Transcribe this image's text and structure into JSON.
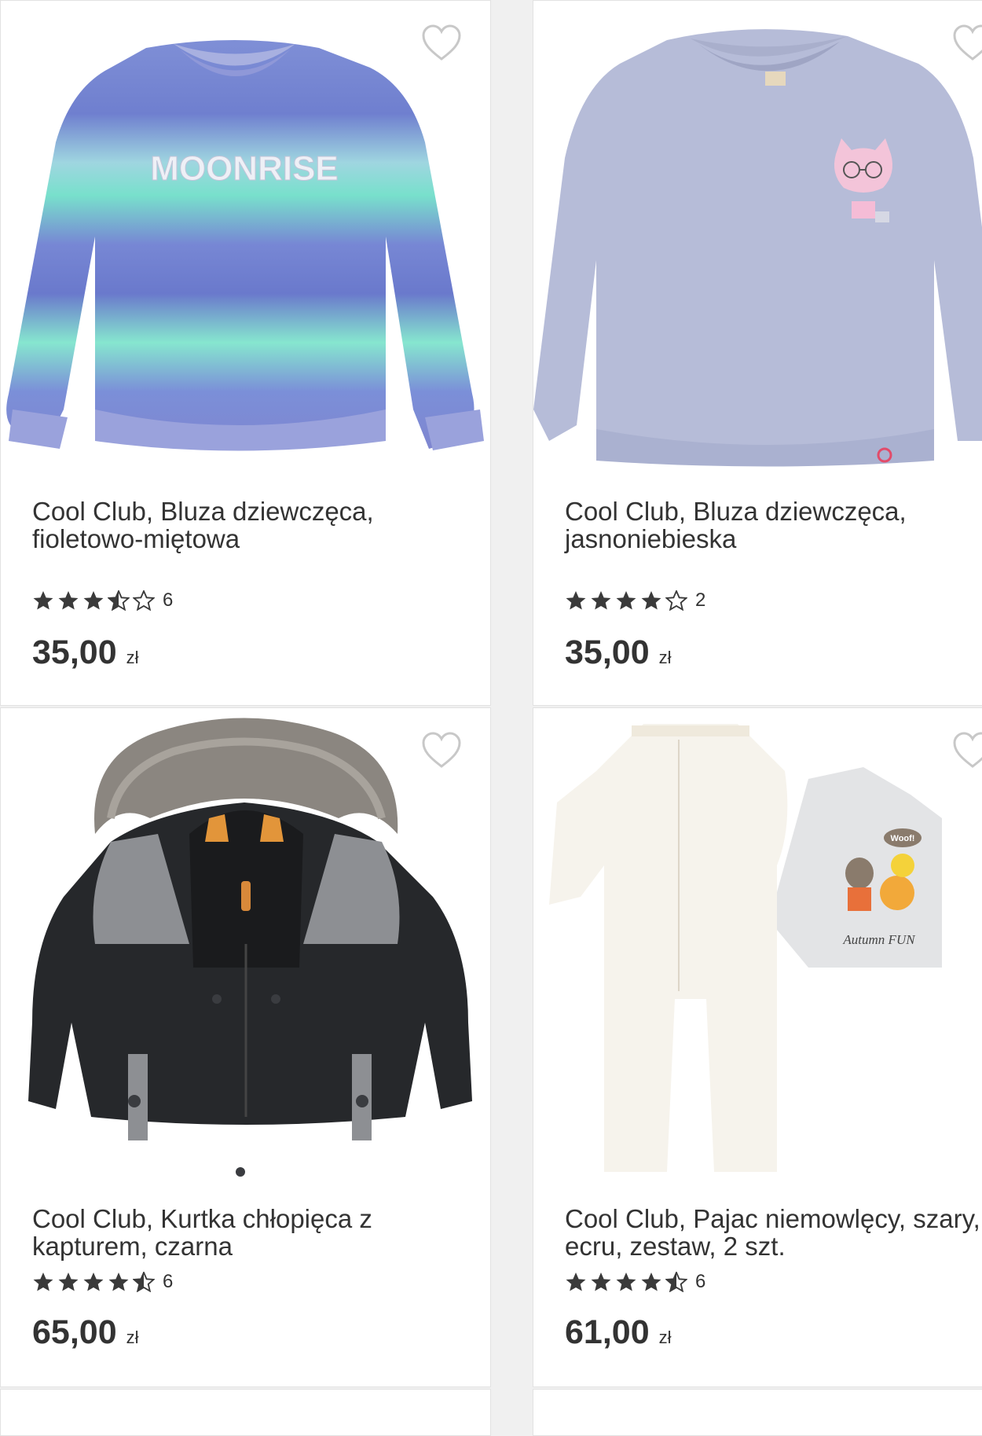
{
  "products": [
    {
      "title_line1": "Cool Club, Bluza dziewczęca,",
      "title_line2": "fioletowo-miętowa",
      "stars": [
        1,
        1,
        1,
        0.5,
        0
      ],
      "reviews": "6",
      "price": "35,00",
      "currency": "zł",
      "print_text": "MOONRISE",
      "image": "sweatshirt-ombre-icon"
    },
    {
      "title_line1": "Cool Club, Bluza dziewczęca,",
      "title_line2": "jasnoniebieska",
      "stars": [
        1,
        1,
        1,
        1,
        0
      ],
      "reviews": "2",
      "price": "35,00",
      "currency": "zł",
      "image": "sweatshirt-blue-icon"
    },
    {
      "title_line1": "Cool Club, Kurtka chłopięca z",
      "title_line2": "kapturem, czarna",
      "stars": [
        1,
        1,
        1,
        1,
        0.5
      ],
      "reviews": "6",
      "price": "65,00",
      "currency": "zł",
      "image": "winter-jacket-icon"
    },
    {
      "title_line1": "Cool Club, Pajac niemowlęcy, szary,",
      "title_line2": "ecru, zestaw, 2 szt.",
      "stars": [
        1,
        1,
        1,
        1,
        0.5
      ],
      "reviews": "6",
      "price": "61,00",
      "currency": "zł",
      "print_text": "Autumn FUN",
      "bubble_text": "Woof!",
      "image": "baby-romper-set-icon"
    }
  ],
  "colors": {
    "star": "#3a3a3a",
    "heart_outline": "#c8c8c8",
    "card_border": "#e2e2e2",
    "background": "#f0f0f0"
  }
}
